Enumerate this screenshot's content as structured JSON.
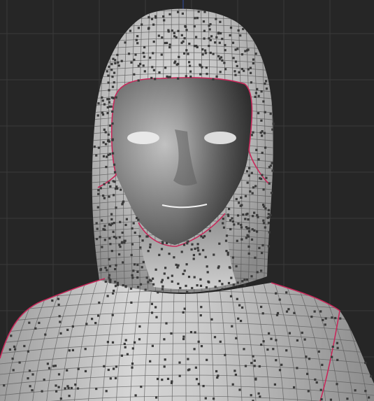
{
  "viewport": {
    "view": "front",
    "shading": "smooth-shaded-with-wireframe",
    "background_color": "#262626",
    "grid_color": "#3a3a3a",
    "grid_axis_color": "#2c3a64",
    "mesh_base_color": "#a9a9a9",
    "mesh_highlight_color": "#dcdcdc",
    "mesh_shadow_color": "#4a4a4a",
    "wire_color": "#5a5a5a",
    "vertex_color": "#3a3a3a",
    "seam_color": "#c8285a",
    "grid_visible": true,
    "selection_active": false
  }
}
